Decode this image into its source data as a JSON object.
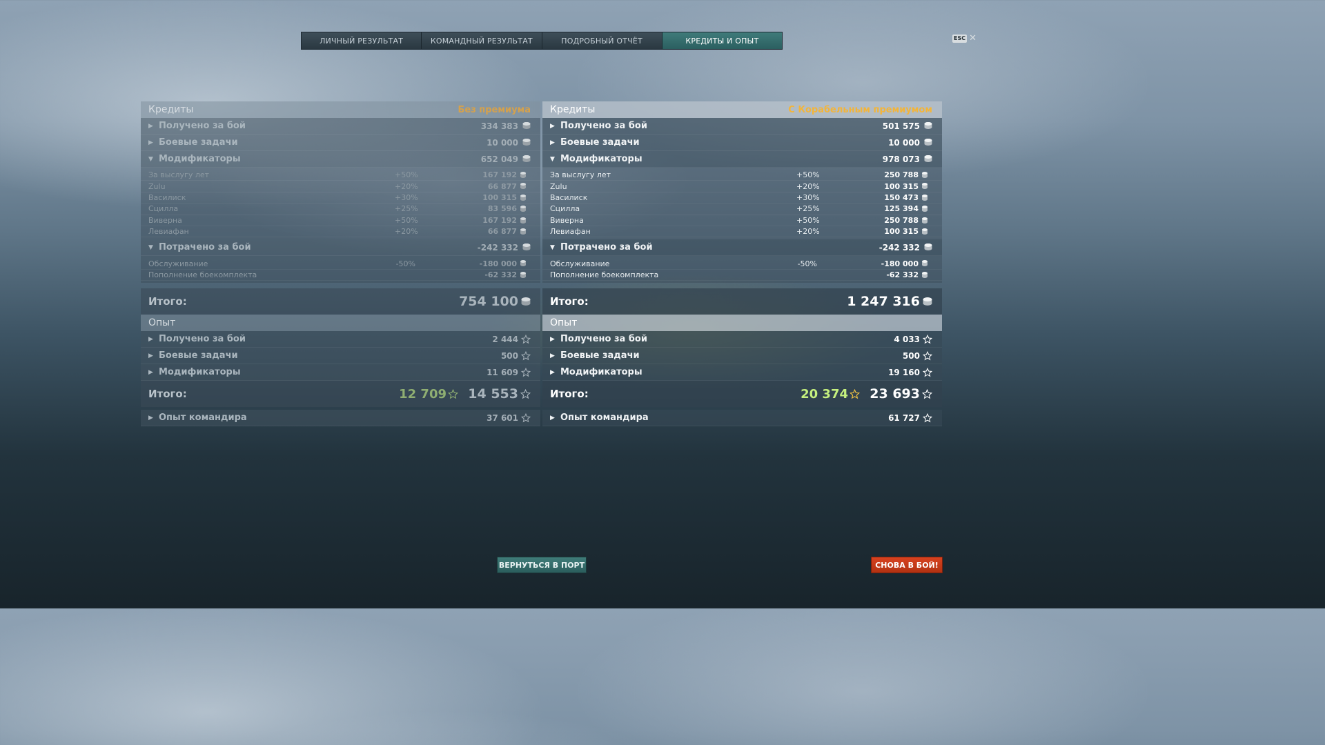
{
  "tabs": [
    {
      "label": "ЛИЧНЫЙ РЕЗУЛЬТАТ",
      "active": false
    },
    {
      "label": "КОМАНДНЫЙ РЕЗУЛЬТАТ",
      "active": false
    },
    {
      "label": "ПОДРОБНЫЙ ОТЧЁТ",
      "active": false
    },
    {
      "label": "КРЕДИТЫ И ОПЫТ",
      "active": true
    }
  ],
  "esc_label": "ESC",
  "close_glyph": "✕",
  "icons": {
    "credits": "silver-coin-icon",
    "xp": "star-icon",
    "expanded": "triangle-down-icon",
    "collapsed": "triangle-right-icon"
  },
  "colors": {
    "active_tab": "#2e6564",
    "battle_button": "#c93a18",
    "premium_label": "#f3b53a",
    "free_xp_green": "#c5f07e"
  },
  "left": {
    "credits": {
      "title": "Кредиты",
      "mode": "Без премиума",
      "earned": {
        "label": "Получено за бой",
        "value": "334 383"
      },
      "missions": {
        "label": "Боевые задачи",
        "value": "10 000"
      },
      "modifiers": {
        "label": "Модификаторы",
        "value": "652 049",
        "items": [
          {
            "name": "За выслугу лет",
            "pct": "+50%",
            "value": "167 192"
          },
          {
            "name": "Zulu",
            "pct": "+20%",
            "value": "66 877"
          },
          {
            "name": "Василиск",
            "pct": "+30%",
            "value": "100 315"
          },
          {
            "name": "Сцилла",
            "pct": "+25%",
            "value": "83 596"
          },
          {
            "name": "Виверна",
            "pct": "+50%",
            "value": "167 192"
          },
          {
            "name": "Левиафан",
            "pct": "+20%",
            "value": "66 877"
          }
        ]
      },
      "spent": {
        "label": "Потрачено за бой",
        "value": "-242 332",
        "items": [
          {
            "name": "Обслуживание",
            "pct": "-50%",
            "value": "-180 000"
          },
          {
            "name": "Пополнение боекомплекта",
            "pct": "",
            "value": "-62 332"
          }
        ]
      },
      "total": {
        "label": "Итого:",
        "value": "754 100"
      }
    },
    "xp": {
      "title": "Опыт",
      "earned": {
        "label": "Получено за бой",
        "value": "2 444"
      },
      "missions": {
        "label": "Боевые задачи",
        "value": "500"
      },
      "modifiers": {
        "label": "Модификаторы",
        "value": "11 609"
      },
      "total": {
        "label": "Итого:",
        "free": "12 709",
        "value": "14 553"
      },
      "commander": {
        "label": "Опыт командира",
        "value": "37 601"
      }
    }
  },
  "right": {
    "credits": {
      "title": "Кредиты",
      "mode": "С Корабельным премиумом",
      "earned": {
        "label": "Получено за бой",
        "value": "501 575"
      },
      "missions": {
        "label": "Боевые задачи",
        "value": "10 000"
      },
      "modifiers": {
        "label": "Модификаторы",
        "value": "978 073",
        "items": [
          {
            "name": "За выслугу лет",
            "pct": "+50%",
            "value": "250 788"
          },
          {
            "name": "Zulu",
            "pct": "+20%",
            "value": "100 315"
          },
          {
            "name": "Василиск",
            "pct": "+30%",
            "value": "150 473"
          },
          {
            "name": "Сцилла",
            "pct": "+25%",
            "value": "125 394"
          },
          {
            "name": "Виверна",
            "pct": "+50%",
            "value": "250 788"
          },
          {
            "name": "Левиафан",
            "pct": "+20%",
            "value": "100 315"
          }
        ]
      },
      "spent": {
        "label": "Потрачено за бой",
        "value": "-242 332",
        "items": [
          {
            "name": "Обслуживание",
            "pct": "-50%",
            "value": "-180 000"
          },
          {
            "name": "Пополнение боекомплекта",
            "pct": "",
            "value": "-62 332"
          }
        ]
      },
      "total": {
        "label": "Итого:",
        "value": "1 247 316"
      }
    },
    "xp": {
      "title": "Опыт",
      "earned": {
        "label": "Получено за бой",
        "value": "4 033"
      },
      "missions": {
        "label": "Боевые задачи",
        "value": "500"
      },
      "modifiers": {
        "label": "Модификаторы",
        "value": "19 160"
      },
      "total": {
        "label": "Итого:",
        "free": "20 374",
        "value": "23 693"
      },
      "commander": {
        "label": "Опыт командира",
        "value": "61 727"
      }
    }
  },
  "buttons": {
    "port": "ВЕРНУТЬСЯ В ПОРТ",
    "battle": "СНОВА В БОЙ!"
  }
}
